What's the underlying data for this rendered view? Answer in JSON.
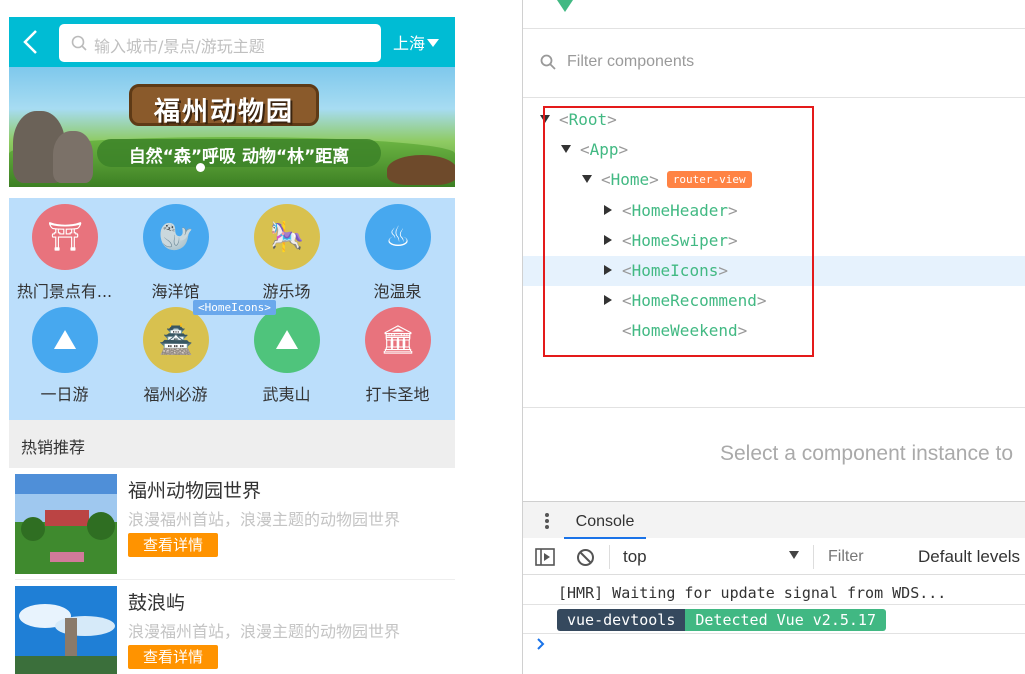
{
  "app": {
    "header": {
      "search_placeholder": "输入城市/景点/游玩主题",
      "city": "上海"
    },
    "banner": {
      "title": "福州动物园",
      "slogan": "自然“森”呼吸  动物“林”距离"
    },
    "icons": [
      {
        "label": "热门景点有...",
        "color": "#e8737d",
        "glyph": "⛩"
      },
      {
        "label": "海洋馆",
        "color": "#47a8ef",
        "glyph": "🦭"
      },
      {
        "label": "游乐场",
        "color": "#d8c14f",
        "glyph": "🎠"
      },
      {
        "label": "泡温泉",
        "color": "#47a8ef",
        "glyph": "♨"
      },
      {
        "label": "一日游",
        "color": "#47a8ef",
        "glyph": "⛰"
      },
      {
        "label": "福州必游",
        "color": "#d8c14f",
        "glyph": "🏯"
      },
      {
        "label": "武夷山",
        "color": "#4fc47c",
        "glyph": "⛰"
      },
      {
        "label": "打卡圣地",
        "color": "#e8737d",
        "glyph": "🏛"
      }
    ],
    "component_tag": "<HomeIcons>",
    "hot_title": "热销推荐",
    "recommend": [
      {
        "name": "福州动物园世界",
        "desc": "浪漫福州首站，浪漫主题的动物园世界",
        "button": "查看详情"
      },
      {
        "name": "鼓浪屿",
        "desc": "浪漫福州首站，浪漫主题的动物园世界",
        "button": "查看详情"
      }
    ]
  },
  "devtools": {
    "filter_placeholder": "Filter components",
    "tree": [
      {
        "name": "Root",
        "arrow": "down"
      },
      {
        "name": "App",
        "arrow": "down"
      },
      {
        "name": "Home",
        "arrow": "down",
        "badge": "router-view"
      },
      {
        "name": "HomeHeader",
        "arrow": "right"
      },
      {
        "name": "HomeSwiper",
        "arrow": "right"
      },
      {
        "name": "HomeIcons",
        "arrow": "right",
        "selected": true
      },
      {
        "name": "HomeRecommend",
        "arrow": "right"
      },
      {
        "name": "HomeWeekend",
        "arrow": "none"
      }
    ],
    "select_message": "Select a component instance to",
    "console": {
      "tab": "Console",
      "context": "top",
      "filter_placeholder": "Filter",
      "levels": "Default levels",
      "log_line": "[HMR] Waiting for update signal from WDS...",
      "badge_left": "vue-devtools",
      "badge_right": "Detected Vue v2.5.17"
    }
  }
}
